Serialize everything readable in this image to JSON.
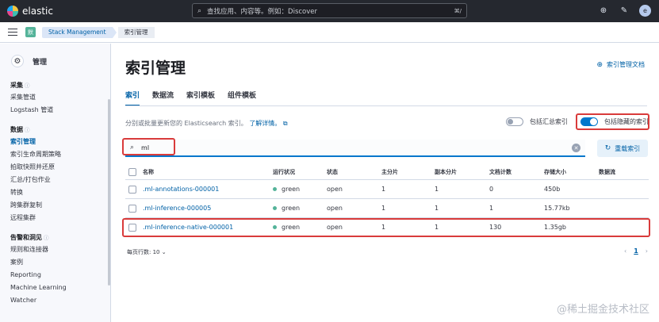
{
  "topbar": {
    "brand": "elastic",
    "search_placeholder": "查找应用、内容等。例如：Discover",
    "search_shortcut": "⌘/",
    "avatar_initial": "e"
  },
  "breadcrumb": {
    "space_badge": "默",
    "items": [
      "Stack Management",
      "索引管理"
    ]
  },
  "sidebar": {
    "title": "管理",
    "groups": [
      {
        "title": "采集",
        "items": [
          {
            "label": "采集管道"
          },
          {
            "label": "Logstash 管道"
          }
        ]
      },
      {
        "title": "数据",
        "items": [
          {
            "label": "索引管理"
          },
          {
            "label": "索引生命周期策略"
          },
          {
            "label": "拍取快照并还原"
          },
          {
            "label": "汇总/打包作业"
          },
          {
            "label": "转换"
          },
          {
            "label": "跨集群复制"
          },
          {
            "label": "远程集群"
          }
        ]
      },
      {
        "title": "告警和洞见",
        "items": [
          {
            "label": "规则和连接器"
          },
          {
            "label": "案例"
          },
          {
            "label": "Reporting"
          },
          {
            "label": "Machine Learning"
          },
          {
            "label": "Watcher"
          }
        ]
      }
    ]
  },
  "main": {
    "title": "索引管理",
    "docs_link": "索引管理文档",
    "tabs": [
      "索引",
      "数据流",
      "索引模板",
      "组件模板"
    ],
    "description": "分别或批量更新您的 Elasticsearch 索引。",
    "learn_more": "了解详情。",
    "toggle_rollup": "包括汇总索引",
    "toggle_hidden": "包括隐藏的索引",
    "search_value": "ml",
    "reload_button": "重载索引",
    "table": {
      "headers": [
        "名称",
        "运行状况",
        "状态",
        "主分片",
        "副本分片",
        "文档计数",
        "存储大小",
        "数据流"
      ],
      "rows": [
        {
          "name": ".ml-annotations-000001",
          "health": "green",
          "status": "open",
          "primary": "1",
          "replica": "1",
          "docs": "0",
          "size": "450b",
          "stream": ""
        },
        {
          "name": ".ml-inference-000005",
          "health": "green",
          "status": "open",
          "primary": "1",
          "replica": "1",
          "docs": "1",
          "size": "15.77kb",
          "stream": ""
        },
        {
          "name": ".ml-inference-native-000001",
          "health": "green",
          "status": "open",
          "primary": "1",
          "replica": "1",
          "docs": "130",
          "size": "1.35gb",
          "stream": ""
        }
      ]
    },
    "rows_per_page": "每页行数: 10",
    "current_page": "1"
  },
  "watermark": "@稀土掘金技术社区",
  "colors": {
    "accent": "#0077cc",
    "highlight": "#d93b3b",
    "health_green": "#54b399"
  }
}
